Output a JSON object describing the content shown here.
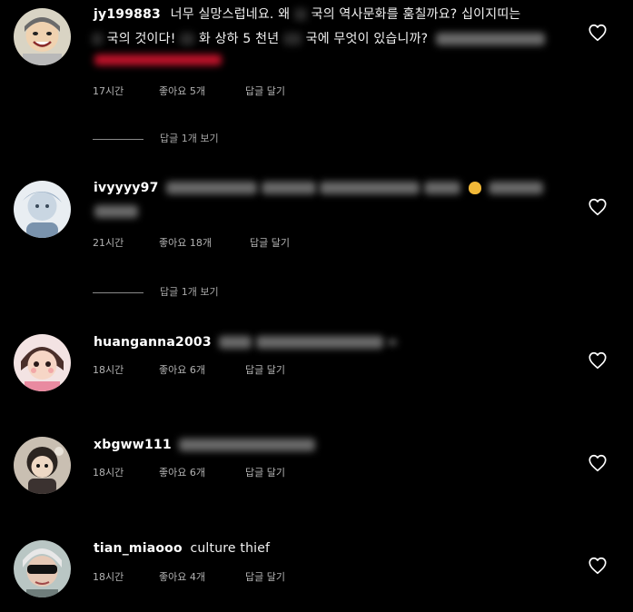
{
  "comments": [
    {
      "username": "jy199883",
      "line1_a": "너무 실망스럽네요. 왜",
      "line1_b": "국의 역사문화를 훔칠까요? 십이지띠는",
      "line2_a": "국의 것이다!",
      "line2_b": "화 상하 5 천년",
      "line2_c": "국에 무엇이 있습니까?",
      "time": "17시간",
      "likes": "좋아요 5개",
      "reply": "답글 달기",
      "view_replies": "답글 1개 보기"
    },
    {
      "username": "ivyyyy97",
      "time": "21시간",
      "likes": "좋아요 18개",
      "reply": "답글 달기",
      "view_replies": "답글 1개 보기"
    },
    {
      "username": "huanganna2003",
      "time": "18시간",
      "likes": "좋아요 6개",
      "reply": "답글 달기"
    },
    {
      "username": "xbgww111",
      "time": "18시간",
      "likes": "좋아요 6개",
      "reply": "답글 달기"
    },
    {
      "username": "tian_miaooo",
      "text": "culture thief",
      "time": "18시간",
      "likes": "좋아요 4개",
      "reply": "답글 달기"
    }
  ],
  "icons": {
    "like": "heart-outline-icon"
  },
  "colors": {
    "background": "#000000",
    "text": "#ffffff",
    "meta": "#b3b3b3",
    "redacted_red": "#c0122a"
  }
}
